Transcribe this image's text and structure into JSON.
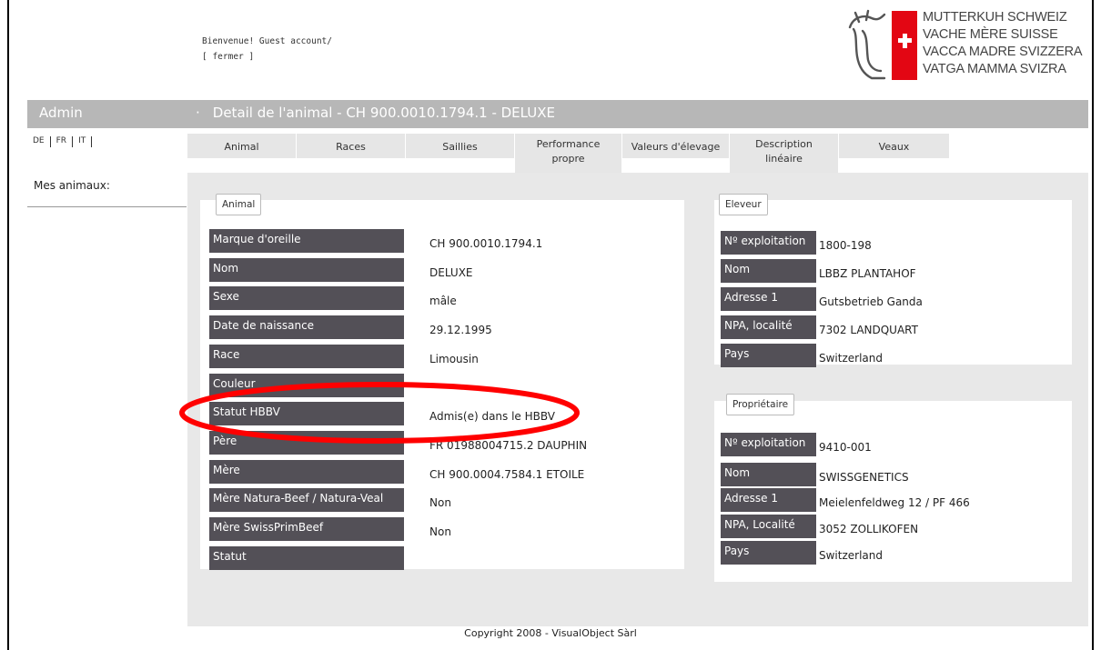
{
  "header": {
    "welcome": "Bienvenue! Guest account/",
    "close_link": "[ fermer ]",
    "logo_lines": [
      "MUTTERKUH SCHWEIZ",
      "VACHE MÈRE SUISSE",
      "VACCA MADRE SVIZZERA",
      "VATGA MAMMA SVIZRA"
    ],
    "cross_color": "#e30613"
  },
  "titlebar": {
    "admin": "Admin",
    "bullet": "·",
    "title": "Detail de l'animal - CH 900.0010.1794.1 - DELUXE"
  },
  "languages": [
    "DE",
    "FR",
    "IT"
  ],
  "sidebar": {
    "my_animals": "Mes animaux:"
  },
  "tabs": [
    {
      "label": "Animal"
    },
    {
      "label": "Races"
    },
    {
      "label": "Saillies"
    },
    {
      "label": "Performance propre"
    },
    {
      "label": "Valeurs d'élevage"
    },
    {
      "label": "Description linéaire"
    },
    {
      "label": "Veaux"
    }
  ],
  "animal": {
    "legend": "Animal",
    "rows": [
      {
        "label": "Marque d'oreille",
        "value": "CH 900.0010.1794.1"
      },
      {
        "label": "Nom",
        "value": "DELUXE"
      },
      {
        "label": "Sexe",
        "value": "mâle"
      },
      {
        "label": "Date de naissance",
        "value": "29.12.1995"
      },
      {
        "label": "Race",
        "value": "Limousin"
      },
      {
        "label": "Couleur",
        "value": ""
      },
      {
        "label": "Statut HBBV",
        "value": "Admis(e) dans le HBBV"
      },
      {
        "label": "Père",
        "value": "FR 01988004715.2  DAUPHIN"
      },
      {
        "label": "Mère",
        "value": "CH 900.0004.7584.1  ETOILE"
      },
      {
        "label": "Mère Natura-Beef / Natura-Veal",
        "value": "Non"
      },
      {
        "label": "Mère SwissPrimBeef",
        "value": "Non"
      },
      {
        "label": "Statut",
        "value": ""
      }
    ]
  },
  "breeder": {
    "legend": "Eleveur",
    "rows": [
      {
        "label": "Nº exploitation",
        "value": "1800-198"
      },
      {
        "label": "Nom",
        "value": "LBBZ PLANTAHOF"
      },
      {
        "label": "Adresse 1",
        "value": "Gutsbetrieb Ganda"
      },
      {
        "label": "NPA, localité",
        "value": "7302  LANDQUART"
      },
      {
        "label": "Pays",
        "value": "Switzerland"
      }
    ]
  },
  "owner": {
    "legend": "Propriétaire",
    "rows": [
      {
        "label": "Nº exploitation",
        "value": "9410-001"
      },
      {
        "label": "Nom",
        "value": "SWISSGENETICS"
      },
      {
        "label": "Adresse 1",
        "value": "Meielenfeldweg 12 / PF 466"
      },
      {
        "label": "NPA, Localité",
        "value": "3052  ZOLLIKOFEN"
      },
      {
        "label": "Pays",
        "value": "Switzerland"
      }
    ]
  },
  "footer": {
    "copyright": "Copyright 2008 - VisualObject Sàrl"
  },
  "annotation": {
    "color": "#ff0000"
  }
}
